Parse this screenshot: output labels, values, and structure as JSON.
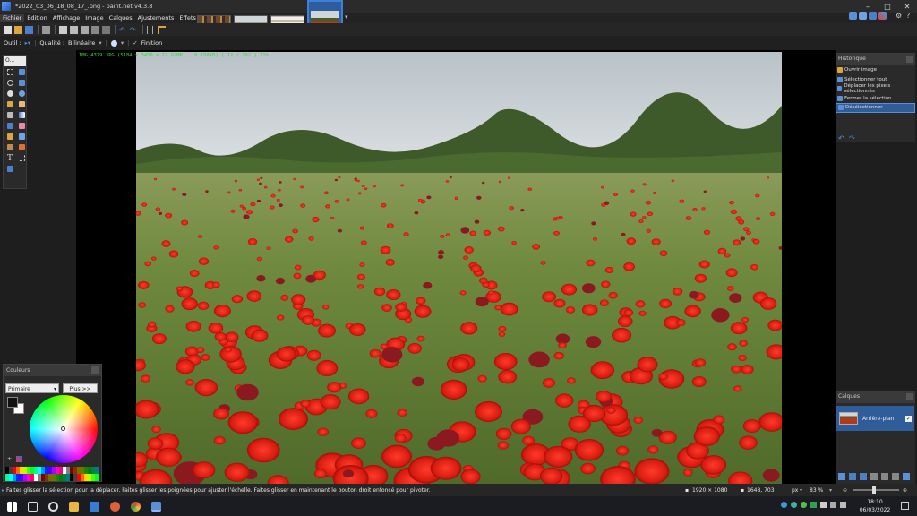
{
  "window": {
    "title": "*2022_03_06_18_08_17_.png - paint.net v4.3.8",
    "controls": {
      "minimize": "–",
      "maximize": "□",
      "close": "✕"
    }
  },
  "menu": [
    "Fichier",
    "Edition",
    "Affichage",
    "Image",
    "Calques",
    "Ajustements",
    "Effets"
  ],
  "options_bar": {
    "tool_label": "Outil :",
    "quality_label": "Qualité :",
    "quality_value": "Bilinéaire",
    "finish_label": "Finition"
  },
  "image_info": "IMG_4379.JPG (5184 x 3456 = 17,92MP , 10 158KB) [ 12 / 102 ]  31%",
  "tools_panel": {
    "header": "O..."
  },
  "colors_panel": {
    "title": "Couleurs",
    "mode": "Primaire",
    "more_button": "Plus >>"
  },
  "history_panel": {
    "title": "Historique",
    "items": [
      {
        "label": "Ouvrir image",
        "color": "#d9a640"
      },
      {
        "label": "Sélectionner tout",
        "color": "#5b8fd6"
      },
      {
        "label": "Déplacer les pixels sélectionnés",
        "color": "#5b8fd6"
      },
      {
        "label": "Fermer la sélection",
        "color": "#5b8fd6"
      },
      {
        "label": "Désélectionner",
        "color": "#5b8fd6"
      }
    ]
  },
  "layers_panel": {
    "title": "Calques",
    "layers": [
      {
        "name": "Arrière-plan",
        "visible": true
      }
    ]
  },
  "status": {
    "hint": "Faites glisser la sélection pour la déplacer. Faites glisser les poignées pour ajuster l'échelle. Faites glisser en maintenant le bouton droit enfoncé pour pivoter.",
    "image_size": "1920 × 1080",
    "cursor_pos": "1648, 703",
    "unit": "px",
    "zoom": "83 %"
  },
  "taskbar": {
    "time": "18:10",
    "date": "06/03/2022"
  },
  "colors": {
    "accent": "#2f5d9a",
    "overlay_text": "#33dd33",
    "primary_color": "#111111",
    "secondary_color": "#ffffff"
  }
}
